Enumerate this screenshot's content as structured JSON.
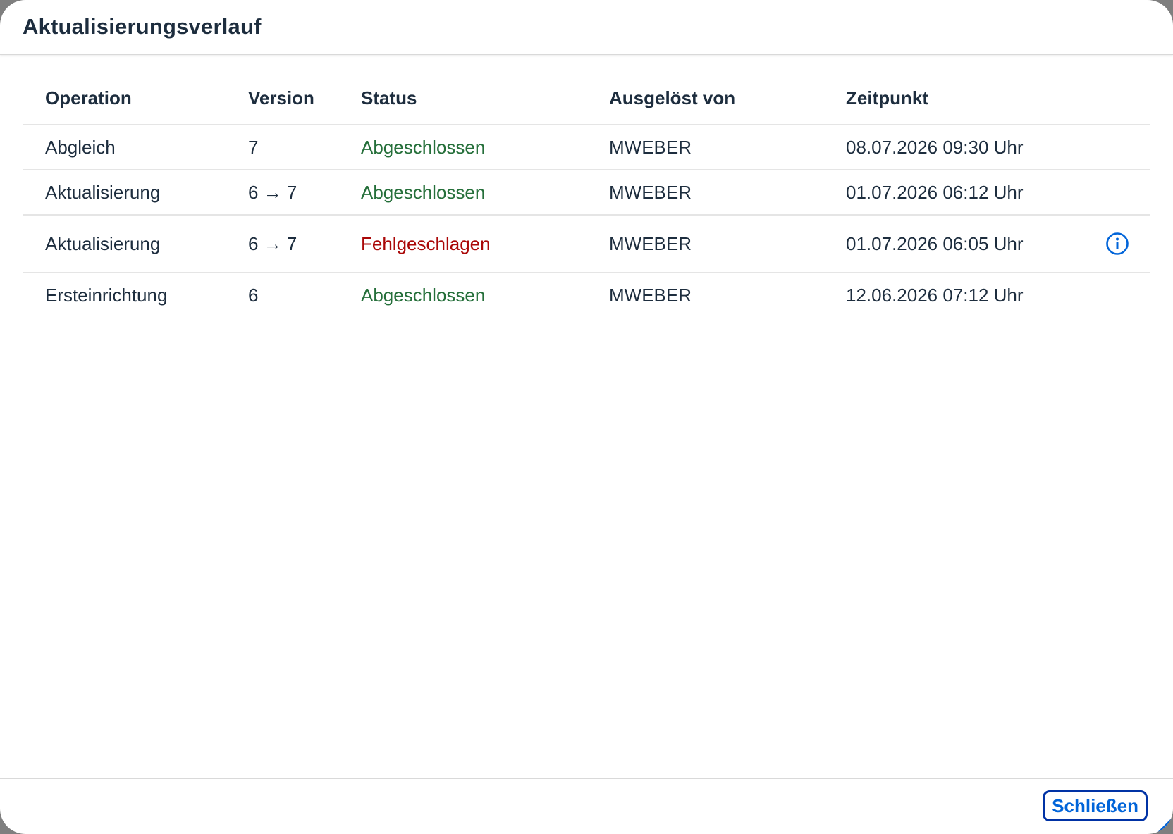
{
  "dialog": {
    "title": "Aktualisierungsverlauf",
    "close_label": "Schließen"
  },
  "table": {
    "columns": [
      "Operation",
      "Version",
      "Status",
      "Ausgelöst von",
      "Zeitpunkt"
    ],
    "rows": [
      {
        "operation": "Abgleich",
        "version": "7",
        "status": "Abgeschlossen",
        "status_kind": "success",
        "user": "MWEBER",
        "time": "08.07.2026 09:30 Uhr",
        "info": false
      },
      {
        "operation": "Aktualisierung",
        "version": "6 → 7",
        "status": "Abgeschlossen",
        "status_kind": "success",
        "user": "MWEBER",
        "time": "01.07.2026 06:12 Uhr",
        "info": false
      },
      {
        "operation": "Aktualisierung",
        "version": "6 → 7",
        "status": "Fehlgeschlagen",
        "status_kind": "error",
        "user": "MWEBER",
        "time": "01.07.2026 06:05 Uhr",
        "info": true
      },
      {
        "operation": "Ersteinrichtung",
        "version": "6",
        "status": "Abgeschlossen",
        "status_kind": "success",
        "user": "MWEBER",
        "time": "12.06.2026 07:12 Uhr",
        "info": false
      }
    ]
  },
  "icons": {
    "info": "info-icon",
    "resize": "resize-handle-icon"
  },
  "colors": {
    "success": "#256f3a",
    "error": "#aa0808",
    "accent": "#0064d9",
    "button_border": "#0032a5"
  }
}
